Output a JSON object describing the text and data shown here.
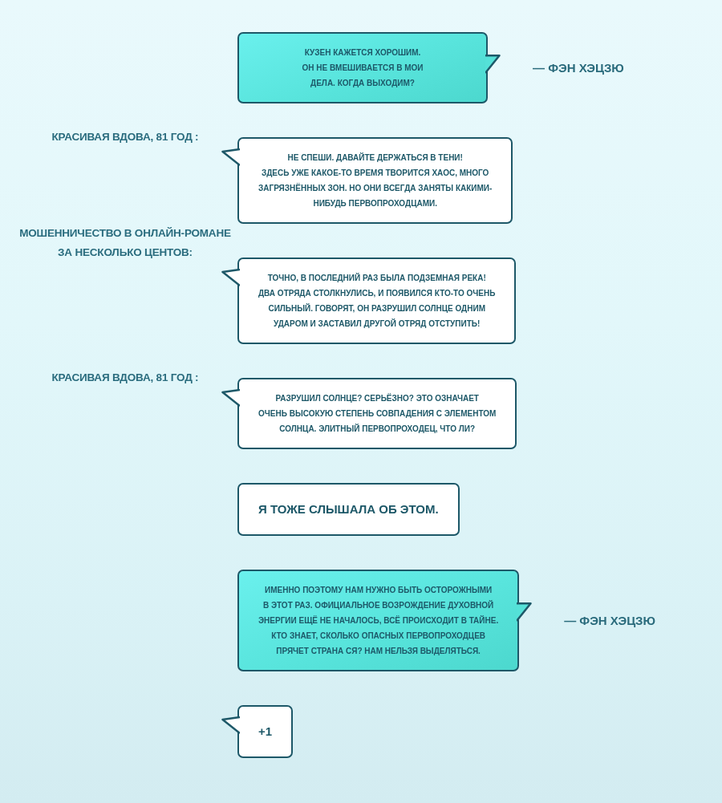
{
  "messages": [
    {
      "kind": "own",
      "text": "КУЗЕН КАЖЕТСЯ ХОРОШИМ.\nОН НЕ ВМЕШИВАЕТСЯ В МОИ\nДЕЛА. КОГДА ВЫХОДИМ?",
      "author": "— ФЭН ХЭЦЗЮ"
    },
    {
      "kind": "other",
      "sender": "КРАСИВАЯ ВДОВА, 81 ГОД :",
      "text": "НЕ СПЕШИ. ДАВАЙТЕ ДЕРЖАТЬСЯ В ТЕНИ!\nЗДЕСЬ УЖЕ КАКОЕ-ТО ВРЕМЯ ТВОРИТСЯ ХАОС, МНОГО\nЗАГРЯЗНЁННЫХ ЗОН. НО ОНИ ВСЕГДА ЗАНЯТЫ КАКИМИ-\nНИБУДЬ ПЕРВОПРОХОДЦАМИ."
    },
    {
      "kind": "other",
      "sender": "МОШЕННИЧЕСТВО В ОНЛАЙН-РОМАНЕ\nЗА НЕСКОЛЬКО ЦЕНТОВ:",
      "text": "ТОЧНО, В ПОСЛЕДНИЙ РАЗ БЫЛА ПОДЗЕМНАЯ РЕКА!\nДВА ОТРЯДА СТОЛКНУЛИСЬ, И ПОЯВИЛСЯ КТО-ТО ОЧЕНЬ\nСИЛЬНЫЙ. ГОВОРЯТ, ОН РАЗРУШИЛ СОЛНЦЕ ОДНИМ\nУДАРОМ И ЗАСТАВИЛ ДРУГОЙ ОТРЯД ОТСТУПИТЬ!"
    },
    {
      "kind": "other",
      "sender": "КРАСИВАЯ ВДОВА, 81 ГОД :",
      "text": "РАЗРУШИЛ СОЛНЦЕ? СЕРЬЁЗНО? ЭТО ОЗНАЧАЕТ\nОЧЕНЬ ВЫСОКУЮ СТЕПЕНЬ СОВПАДЕНИЯ С ЭЛЕМЕНТОМ\nСОЛНЦА. ЭЛИТНЫЙ ПЕРВОПРОХОДЕЦ, ЧТО ЛИ?"
    },
    {
      "kind": "caption",
      "text": "Я ТОЖЕ СЛЫШАЛА ОБ ЭТОМ.",
      "large": true
    },
    {
      "kind": "own",
      "text": "ИМЕННО ПОЭТОМУ НАМ НУЖНО БЫТЬ ОСТОРОЖНЫМИ\nВ ЭТОТ РАЗ. ОФИЦИАЛЬНОЕ ВОЗРОЖДЕНИЕ ДУХОВНОЙ\nЭНЕРГИИ ЕЩЁ НЕ НАЧАЛОСЬ, ВСЁ ПРОИСХОДИТ В ТАЙНЕ.\nКТО ЗНАЕТ, СКОЛЬКО ОПАСНЫХ ПЕРВОПРОХОДЦЕВ\nПРЯЧЕТ СТРАНА СЯ? НАМ НЕЛЬЗЯ ВЫДЕЛЯТЬСЯ.",
      "author": "— ФЭН ХЭЦЗЮ"
    },
    {
      "kind": "other",
      "text": "+1",
      "large": true
    }
  ]
}
